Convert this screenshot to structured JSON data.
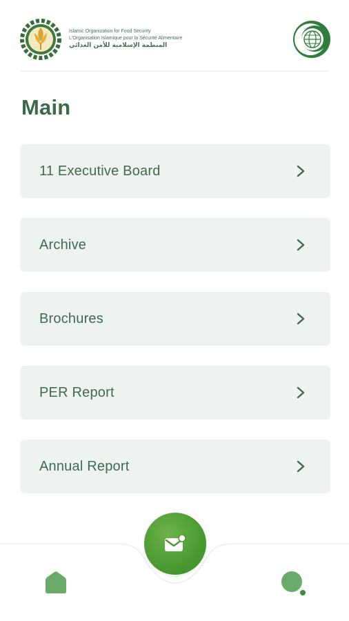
{
  "header": {
    "brand_name_en": "Islamic Organization for Food Security",
    "brand_name_fr": "L'Organisation Islamique pour la Sécurité Alimentaire",
    "brand_name_ar": "المنظمة الإسلامية للأمن الغذائي"
  },
  "page": {
    "title": "Main"
  },
  "menu": {
    "items": [
      {
        "label": "11 Executive Board"
      },
      {
        "label": "Archive"
      },
      {
        "label": "Brochures"
      },
      {
        "label": "PER Report"
      },
      {
        "label": "Annual Report"
      }
    ]
  },
  "bottom_nav": {
    "home_icon": "home-icon",
    "center_icon": "mail-notification-icon",
    "profile_icon": "profile-icon"
  },
  "colors": {
    "primary_green": "#4a9a30",
    "text_green": "#3f6a4d",
    "card_bg": "#eef3ef",
    "icon_green": "#6aaa6a"
  }
}
